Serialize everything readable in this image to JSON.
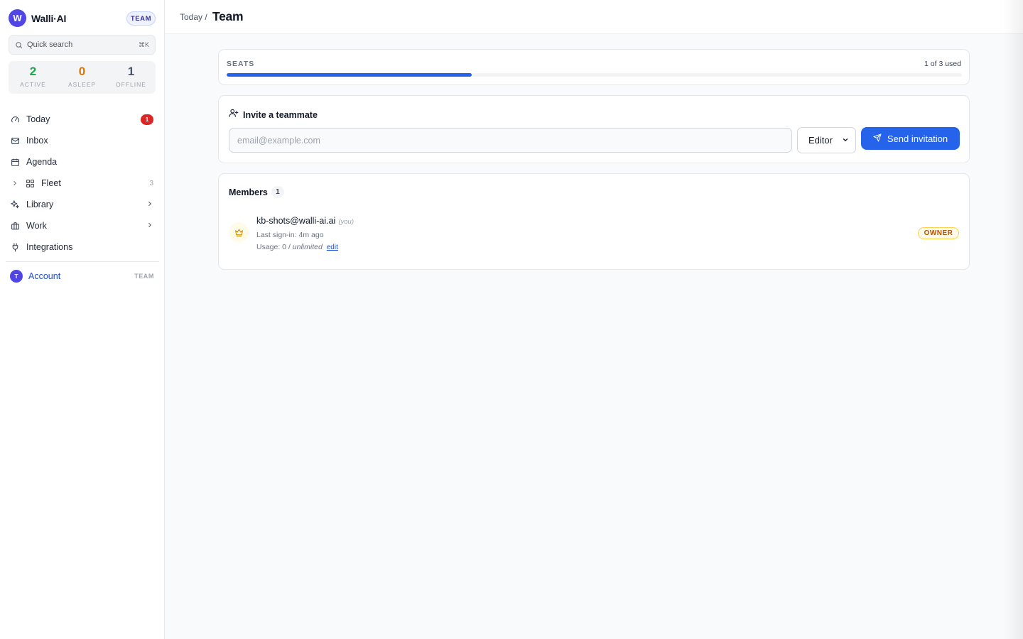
{
  "brand": {
    "logo_letter": "W",
    "name": "Walli·AI",
    "plan": "TEAM"
  },
  "search": {
    "placeholder": "Quick search",
    "shortcut": "⌘K"
  },
  "stats": [
    {
      "value": "2",
      "label": "ACTIVE",
      "color": "#16a34a"
    },
    {
      "value": "0",
      "label": "ASLEEP",
      "color": "#d97706"
    },
    {
      "value": "1",
      "label": "OFFLINE",
      "color": "#475569"
    }
  ],
  "nav": {
    "today": {
      "label": "Today",
      "badge": "1",
      "icon": "speedometer-icon"
    },
    "inbox": {
      "label": "Inbox",
      "icon": "mail-icon"
    },
    "agenda": {
      "label": "Agenda",
      "icon": "calendar-icon"
    },
    "fleet": {
      "label": "Fleet",
      "count": "3",
      "icon": "grid-icon"
    },
    "library": {
      "label": "Library",
      "icon": "sparkles-icon"
    },
    "work": {
      "label": "Work",
      "icon": "briefcase-icon"
    },
    "integrations": {
      "label": "Integrations",
      "icon": "plug-icon"
    }
  },
  "account": {
    "avatar": "T",
    "label": "Account",
    "plan": "TEAM"
  },
  "header": {
    "breadcrumb": "Today /",
    "title": "Team"
  },
  "seats": {
    "title": "SEATS",
    "used_text": "1 of 3 used",
    "used_fraction": 0.333,
    "accent": "#2563eb"
  },
  "invite": {
    "title": "Invite a teammate",
    "email_placeholder": "email@example.com",
    "role_selected": "Editor",
    "send_label": "Send invitation"
  },
  "members": {
    "title": "Members",
    "count": "1",
    "items": [
      {
        "email": "kb-shots@walli-ai.ai",
        "you_label": "(you)",
        "last_signin": "Last sign-in: 4m ago",
        "usage_prefix": "Usage: 0 /",
        "usage_limit": "unlimited",
        "edit_label": "edit",
        "role": "OWNER",
        "icon": "crown-icon"
      }
    ]
  }
}
